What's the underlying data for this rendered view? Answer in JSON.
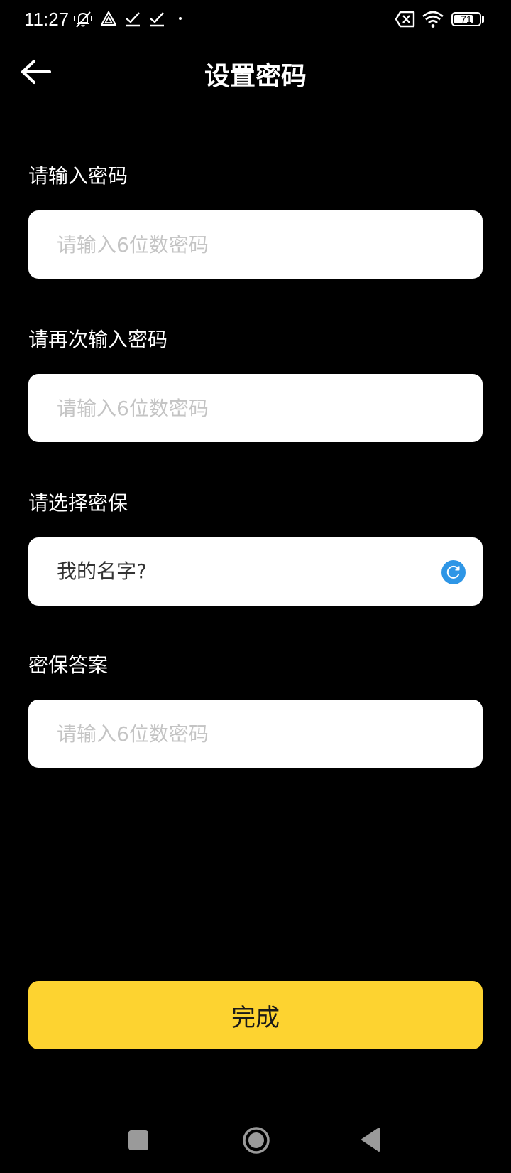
{
  "status_bar": {
    "time": "11:27",
    "battery": "71",
    "icons": [
      "notification-muted-icon",
      "app-notification-icon",
      "check-icon",
      "check-icon",
      "dot-icon",
      "no-sim-icon",
      "wifi-icon",
      "battery-icon"
    ]
  },
  "header": {
    "title": "设置密码",
    "back_icon": "arrow-left-icon"
  },
  "form": {
    "password": {
      "label": "请输入密码",
      "placeholder": "请输入6位数密码",
      "value": ""
    },
    "confirm_password": {
      "label": "请再次输入密码",
      "placeholder": "请输入6位数密码",
      "value": ""
    },
    "security_question": {
      "label": "请选择密保",
      "value": "我的名字?",
      "icon": "refresh-icon"
    },
    "security_answer": {
      "label": "密保答案",
      "placeholder": "请输入6位数密码",
      "value": ""
    }
  },
  "actions": {
    "done_label": "完成"
  },
  "nav_bar": {
    "icons": [
      "recents-square-icon",
      "home-circle-icon",
      "back-triangle-icon"
    ]
  },
  "colors": {
    "background": "#000000",
    "field_bg": "#ffffff",
    "primary_button": "#fdd330",
    "accent_icon": "#2e96e6",
    "placeholder": "#c4c4c4"
  }
}
